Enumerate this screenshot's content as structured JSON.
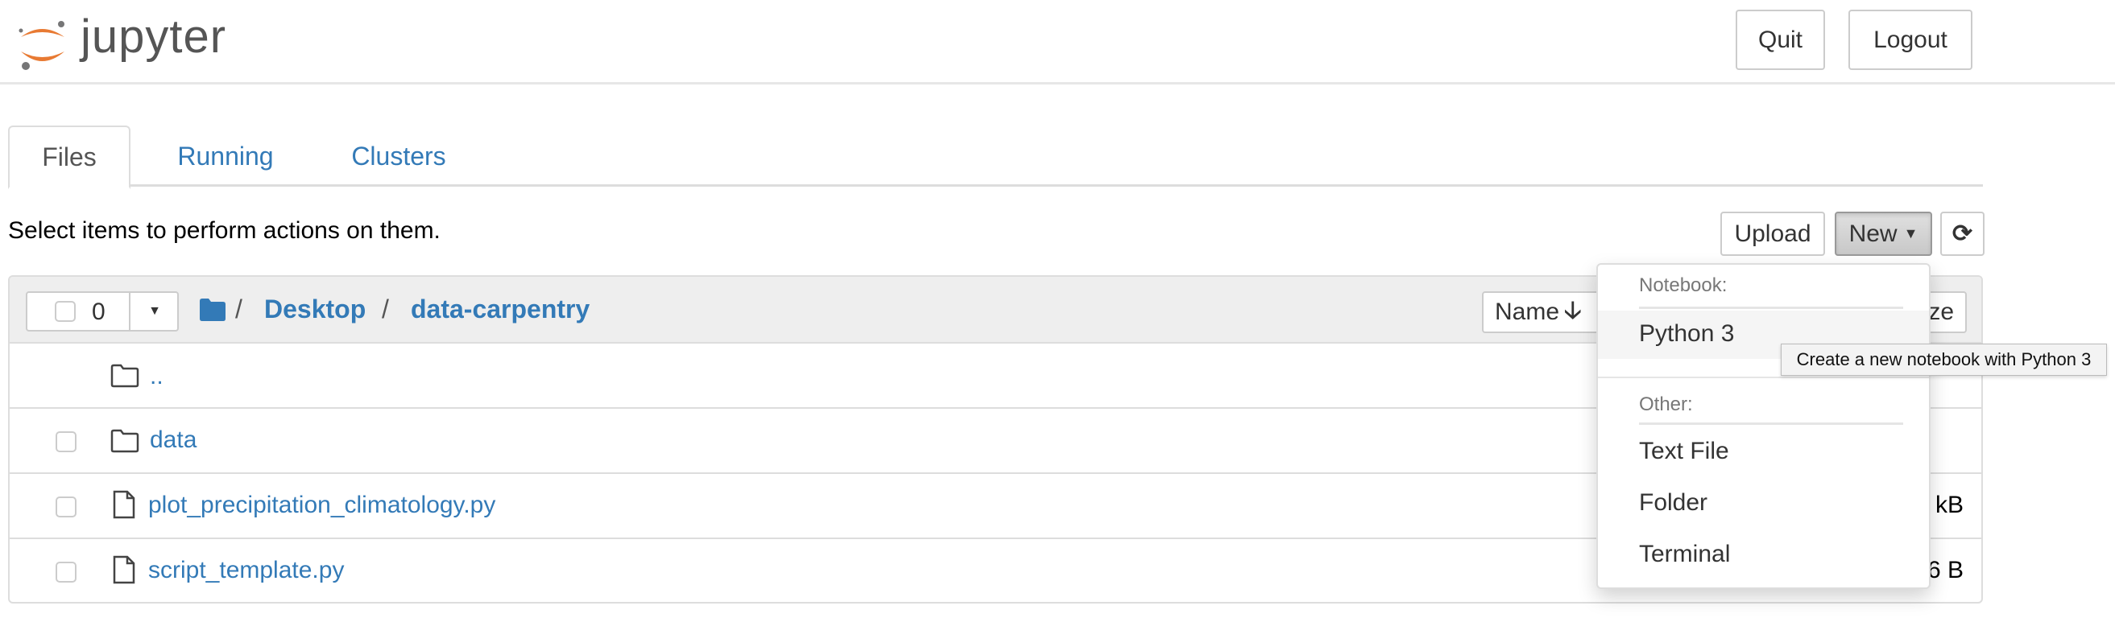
{
  "header": {
    "logo_text": "jupyter",
    "quit_label": "Quit",
    "logout_label": "Logout"
  },
  "tabs": [
    {
      "label": "Files",
      "active": true
    },
    {
      "label": "Running"
    },
    {
      "label": "Clusters"
    }
  ],
  "hint": "Select items to perform actions on them.",
  "toolbar": {
    "upload_label": "Upload",
    "new_label": "New",
    "refresh_icon": "refresh-icon"
  },
  "list": {
    "selected_count": "0",
    "breadcrumb": [
      {
        "label": "/"
      },
      {
        "label": "Desktop"
      },
      {
        "label": "/"
      },
      {
        "label": "data-carpentry"
      }
    ],
    "sort_label": "Name",
    "size_label_partial": "ze",
    "rows": [
      {
        "name": "..",
        "type": "folder",
        "size": ""
      },
      {
        "name": "data",
        "type": "folder",
        "size": ""
      },
      {
        "name": "plot_precipitation_climatology.py",
        "type": "file",
        "size": "kB"
      },
      {
        "name": "script_template.py",
        "type": "file",
        "size": "6 B"
      }
    ]
  },
  "new_menu": {
    "notebook_header": "Notebook:",
    "python3": "Python 3",
    "other_header": "Other:",
    "text_file": "Text File",
    "folder": "Folder",
    "terminal": "Terminal"
  },
  "tooltip": "Create a new notebook with Python 3",
  "colors": {
    "link": "#337ab7",
    "logo_orange": "#e87a33",
    "logo_gray": "#767677"
  }
}
